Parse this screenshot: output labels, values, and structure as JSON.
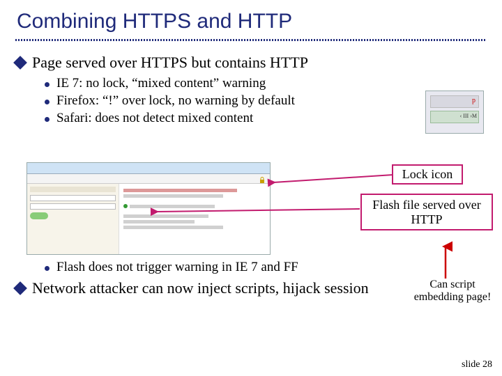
{
  "title": "Combining HTTPS and HTTP",
  "bullets": {
    "b1": "Page served over HTTPS but contains HTTP",
    "subs": {
      "s1": "IE 7: no lock, “mixed content” warning",
      "s2": "Firefox: “!” over lock, no warning by default",
      "s3": "Safari: does not detect mixed content",
      "s4": "Flash does not trigger warning in IE 7 and FF"
    },
    "b2": "Network attacker can now inject scripts, hijack session"
  },
  "callouts": {
    "lock": "Lock icon",
    "flash": "Flash file served over HTTP",
    "can": "Can script embedding page!"
  },
  "thumb_a": {
    "p_label": "p",
    "m_label": "‹ III ›M"
  },
  "footer": "slide 28"
}
